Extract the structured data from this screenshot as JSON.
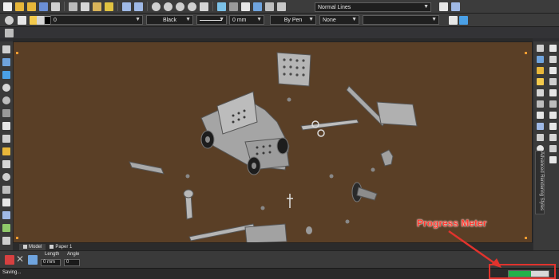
{
  "toolbar": {
    "layer_value": "0",
    "color_value": "Black",
    "linewidth_value": "0 mm",
    "pen_value": "By Pen",
    "hatch_value": "None",
    "linetype_value": "Normal Lines"
  },
  "tabs": {
    "model": "Model",
    "paper": "Paper 1"
  },
  "input": {
    "length_label": "Length",
    "angle_label": "Angle",
    "length_value": "0 mm",
    "angle_value": "0"
  },
  "sidebar": {
    "panel_label": "Advanced Rendering Styles"
  },
  "status": {
    "text": "Saving...",
    "progress": 0.55
  },
  "annotation": {
    "label": "Progress Meter"
  },
  "colors": {
    "viewport_bg": "#5a3f26",
    "progress_fill": "#21b14a",
    "annotation": "#e1332d"
  }
}
